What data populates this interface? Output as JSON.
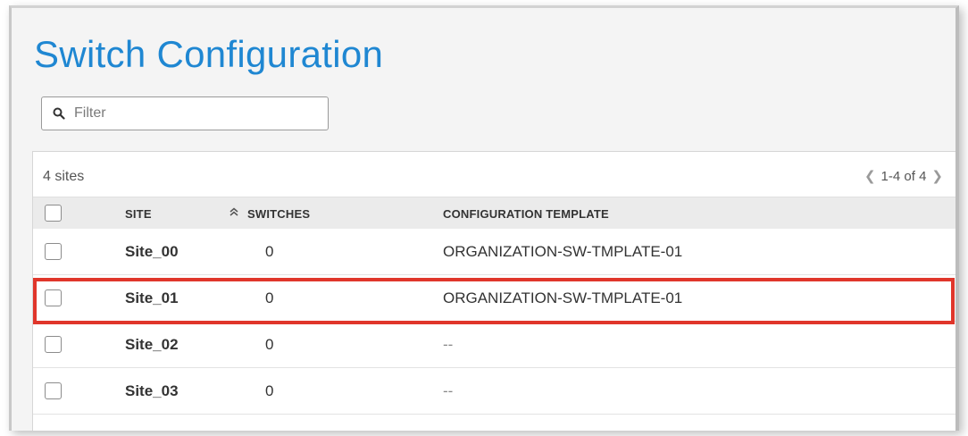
{
  "page": {
    "title": "Switch Configuration"
  },
  "filter": {
    "placeholder": "Filter"
  },
  "summary": {
    "count_label": "4 sites",
    "pagination": "1-4 of 4"
  },
  "table": {
    "headers": {
      "site": "SITE",
      "switches": "SWITCHES",
      "template": "CONFIGURATION TEMPLATE"
    },
    "rows": [
      {
        "site": "Site_00",
        "switches": "0",
        "template": "ORGANIZATION-SW-TMPLATE-01"
      },
      {
        "site": "Site_01",
        "switches": "0",
        "template": "ORGANIZATION-SW-TMPLATE-01"
      },
      {
        "site": "Site_02",
        "switches": "0",
        "template": "--"
      },
      {
        "site": "Site_03",
        "switches": "0",
        "template": "--"
      }
    ]
  },
  "colors": {
    "accent": "#1f87d2",
    "highlight": "#e0362b"
  },
  "icons": {
    "filter": "search-icon",
    "sort": "sort-up-icon",
    "prev": "chevron-left-icon",
    "next": "chevron-right-icon"
  }
}
